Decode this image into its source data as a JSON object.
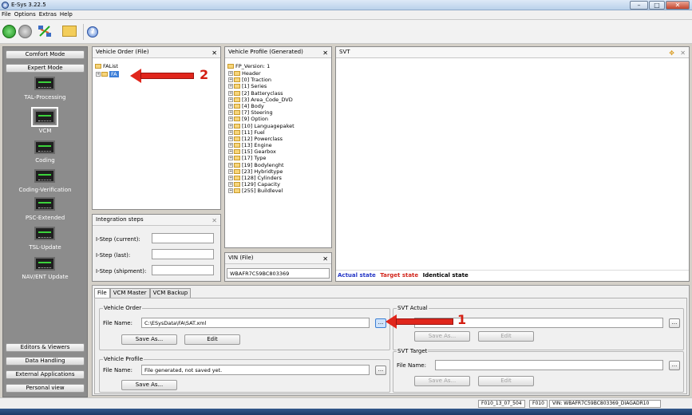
{
  "app": {
    "title": "E-Sys 3.22.5"
  },
  "menu": [
    "File",
    "Options",
    "Extras",
    "Help"
  ],
  "sidebar": {
    "modes": [
      "Comfort Mode",
      "Expert Mode"
    ],
    "nav": [
      "TAL-Processing",
      "VCM",
      "Coding",
      "Coding-Verification",
      "PSC-Extended",
      "TSL-Update",
      "NAV/ENT Update"
    ],
    "bottom": [
      "Editors & Viewers",
      "Data Handling",
      "External Applications",
      "Personal view"
    ]
  },
  "vehicle_order": {
    "title": "Vehicle Order (File)",
    "root": "FAList",
    "child": "FA"
  },
  "vehicle_profile": {
    "title": "Vehicle Profile (Generated)",
    "root": "FP_Version: 1",
    "items": [
      "Header",
      "[0] Traction",
      "[1] Series",
      "[2] Batteryclass",
      "[3] Area_Code_DVD",
      "[4] Body",
      "[7] Steering",
      "[9] Option",
      "[10] Languagepaket",
      "[11] Fuel",
      "[12] Powerclass",
      "[13] Engine",
      "[15] Gearbox",
      "[17] Type",
      "[19] Bodylenght",
      "[23] Hybridtype",
      "[128] Cylinders",
      "[129] Capacity",
      "[255] Buildlevel"
    ]
  },
  "svt": {
    "title": "SVT",
    "legend_actual": "Actual state",
    "legend_target": "Target state",
    "legend_identical": "Identical state",
    "colors": {
      "actual": "#2436c6",
      "target": "#d2261c",
      "identical": "#000000"
    }
  },
  "integration": {
    "title": "Integration steps",
    "current_label": "I-Step (current):",
    "last_label": "I-Step (last):",
    "shipment_label": "I-Step (shipment):",
    "current": "",
    "last": "",
    "shipment": ""
  },
  "vin": {
    "title": "VIN (File)",
    "value": "WBAFR7C59BC803369"
  },
  "tabs": [
    "File",
    "VCM Master",
    "VCM Backup"
  ],
  "file_tab": {
    "vehicle_order_group": "Vehicle Order",
    "file_name_label": "File Name:",
    "vo_path": "C:\\ESysData\\FA\\SAT.xml",
    "save_as": "Save As...",
    "edit": "Edit",
    "vehicle_profile_group": "Vehicle Profile",
    "vp_path": "File generated, not saved yet.",
    "svt_actual_group": "SVT Actual",
    "svt_target_group": "SVT Target",
    "svt_actual_path": "",
    "svt_target_path": ""
  },
  "annotations": {
    "one": "1",
    "two": "2"
  },
  "status": {
    "istep": "F010_13_07_504",
    "series": "F010",
    "vin": "VIN: WBAFR7C59BC803369_DIAGADR10"
  }
}
